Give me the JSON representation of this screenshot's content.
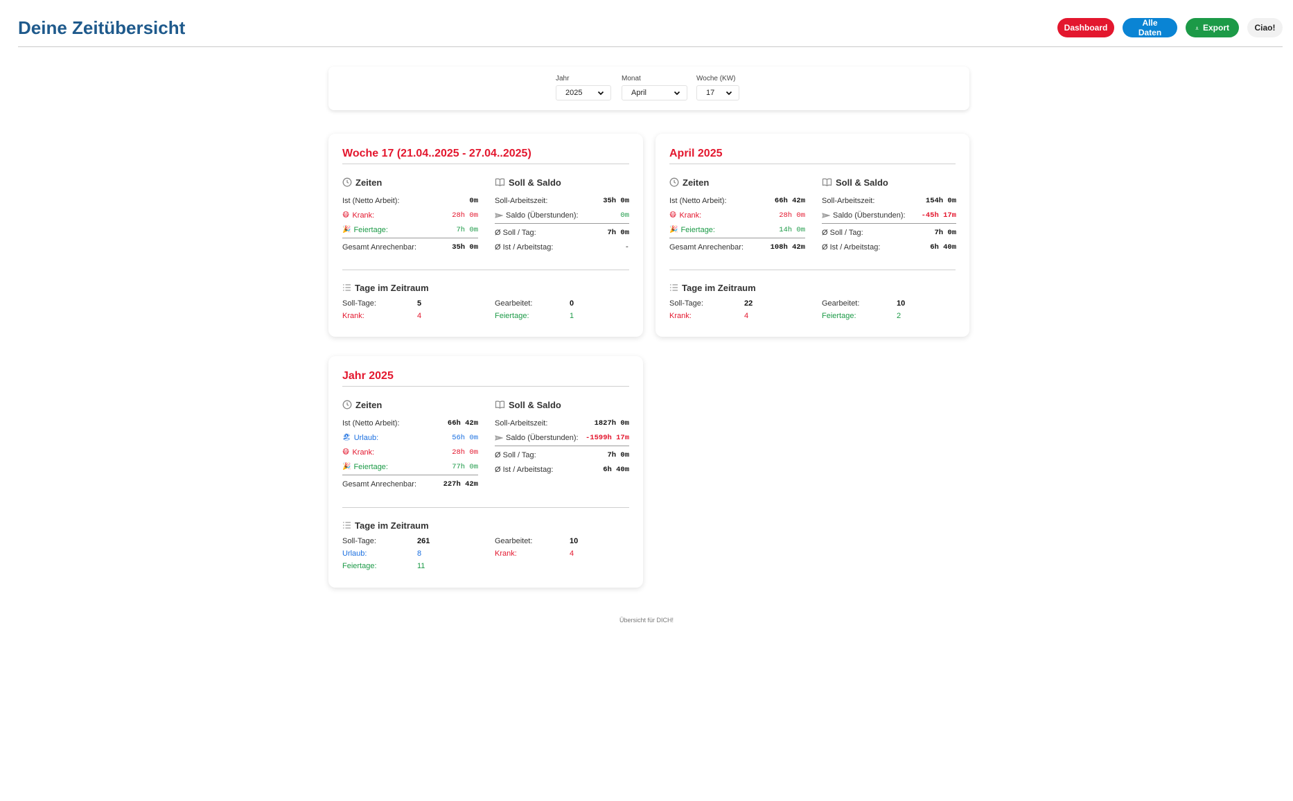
{
  "header": {
    "title": "Deine Zeitübersicht",
    "nav": {
      "dashboard": "Dashboard",
      "all_data": "Alle Daten",
      "export": "Export",
      "logout": "Ciao!"
    }
  },
  "filters": {
    "year": {
      "label": "Jahr",
      "value": "2025"
    },
    "month": {
      "label": "Monat",
      "value": "April"
    },
    "week": {
      "label": "Woche (KW)",
      "value": "17"
    }
  },
  "labels": {
    "times": "Zeiten",
    "target_balance": "Soll & Saldo",
    "days_in_period": "Tage im Zeitraum",
    "actual": "Ist (Netto Arbeit):",
    "vacation": "Urlaub:",
    "sick": "Krank:",
    "holidays": "Feiertage:",
    "total": "Gesamt Anrechenbar:",
    "target_time": "Soll-Arbeitszeit:",
    "balance": "Saldo (Überstunden):",
    "avg_target_day": "Ø Soll / Tag:",
    "avg_actual_day": "Ø Ist / Arbeitstag:",
    "target_days": "Soll-Tage:",
    "worked": "Gearbeitet:",
    "sick_days": "Krank:",
    "vacation_days": "Urlaub:",
    "holiday_days": "Feiertage:"
  },
  "week": {
    "title": "Woche 17 (21.04..2025 - 27.04..2025)",
    "actual": "0m",
    "sick": "28h 0m",
    "holidays": "7h 0m",
    "total": "35h 0m",
    "target_time": "35h 0m",
    "balance": "0m",
    "avg_target_day": "7h 0m",
    "avg_actual_day": "-",
    "days": {
      "target": "5",
      "worked": "0",
      "sick": "4",
      "holidays": "1"
    }
  },
  "month": {
    "title": "April 2025",
    "actual": "66h 42m",
    "sick": "28h 0m",
    "holidays": "14h 0m",
    "total": "108h 42m",
    "target_time": "154h 0m",
    "balance": "-45h 17m",
    "avg_target_day": "7h 0m",
    "avg_actual_day": "6h 40m",
    "days": {
      "target": "22",
      "worked": "10",
      "sick": "4",
      "holidays": "2"
    }
  },
  "year": {
    "title": "Jahr 2025",
    "actual": "66h 42m",
    "vacation": "56h 0m",
    "sick": "28h 0m",
    "holidays": "77h 0m",
    "total": "227h 42m",
    "target_time": "1827h 0m",
    "balance": "-1599h 17m",
    "avg_target_day": "7h 0m",
    "avg_actual_day": "6h 40m",
    "days": {
      "target": "261",
      "worked": "10",
      "vacation": "8",
      "sick": "4",
      "holidays": "11"
    }
  },
  "footer": "Übersicht für DICH!",
  "colors": {
    "accent_red": "#e3172e",
    "blue": "#0a84d4",
    "green": "#1c9a47",
    "title_blue": "#1f5a8c"
  }
}
